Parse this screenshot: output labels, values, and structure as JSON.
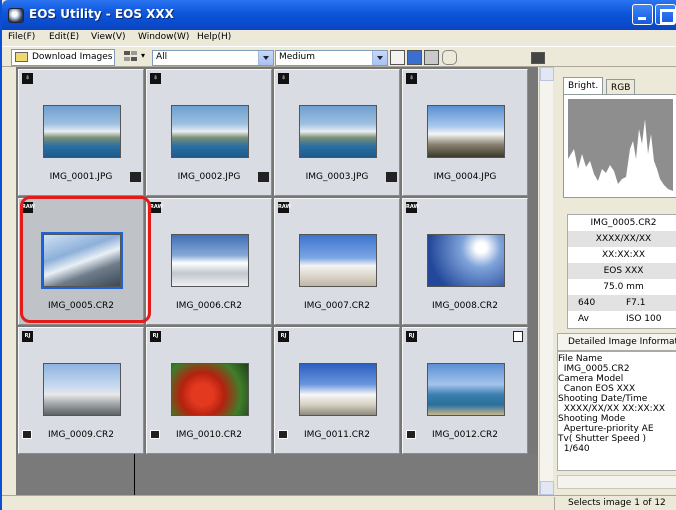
{
  "window": {
    "title": "EOS Utility - EOS XXX",
    "colors": {
      "titlebar": "#0d55d8",
      "selection_ring": "#e21b1b",
      "grid_bg": "#777777"
    }
  },
  "menu": [
    {
      "label": "File(F)",
      "icon": null
    },
    {
      "label": "Edit(E)"
    },
    {
      "label": "View(V)"
    },
    {
      "label": "Window(W)"
    },
    {
      "label": "Help(H)"
    }
  ],
  "toolbar": {
    "download_label": "Download Images",
    "filter_value": "All",
    "size_value": "Medium",
    "icons": [
      "download-icon",
      "sort-icon",
      "fit-icon",
      "select-icon",
      "save-icon",
      "settings-icon",
      "camera-icon"
    ]
  },
  "thumbnails": [
    {
      "name": "IMG_0001.JPG",
      "badge": "⇩",
      "mark": "rate",
      "photo": "harbor"
    },
    {
      "name": "IMG_0002.JPG",
      "badge": "⇩",
      "mark": "rate",
      "photo": "harbor"
    },
    {
      "name": "IMG_0003.JPG",
      "badge": "⇩",
      "mark": "rate",
      "photo": "harbor"
    },
    {
      "name": "IMG_0004.JPG",
      "badge": "⇩",
      "mark": "none",
      "photo": "town"
    },
    {
      "name": "IMG_0005.CR2",
      "badge": "RAW",
      "mark": "none",
      "photo": "cliff",
      "selected": true
    },
    {
      "name": "IMG_0006.CR2",
      "badge": "RAW",
      "mark": "none",
      "photo": "coast"
    },
    {
      "name": "IMG_0007.CR2",
      "badge": "RAW",
      "mark": "none",
      "photo": "windmill"
    },
    {
      "name": "IMG_0008.CR2",
      "badge": "RAW",
      "mark": "none",
      "photo": "windmill2"
    },
    {
      "name": "IMG_0009.CR2",
      "badge": "RAW JPEG",
      "mark": "lock",
      "photo": "terrace"
    },
    {
      "name": "IMG_0010.CR2",
      "badge": "RAW JPEG",
      "mark": "lock",
      "photo": "tomatoes"
    },
    {
      "name": "IMG_0011.CR2",
      "badge": "RAW JPEG",
      "mark": "lock",
      "photo": "village"
    },
    {
      "name": "IMG_0012.CR2",
      "badge": "RAW JPEG",
      "mark": "lock+flag",
      "photo": "sea"
    }
  ],
  "histogram": {
    "tabs": [
      "Bright.",
      "RGB"
    ],
    "active_tab": "Bright."
  },
  "info": {
    "file_name": "IMG_0005.CR2",
    "date": "XXXX/XX/XX",
    "time": "XX:XX:XX",
    "model": "EOS XXX",
    "focal": "75.0 mm",
    "shutter": "640",
    "aperture": "F7.1",
    "mode": "Av",
    "iso": "ISO 100"
  },
  "details": {
    "header": "Detailed Image Information",
    "lines": [
      "File Name",
      "  IMG_0005.CR2",
      "Camera Model",
      "  Canon EOS XXX",
      "Shooting Date/Time",
      "  XXXX/XX/XX XX:XX:XX",
      "Shooting Mode",
      "  Aperture-priority AE",
      "Tv( Shutter Speed )",
      "  1/640"
    ]
  },
  "status": {
    "text": "Selects image 1 of 12"
  }
}
